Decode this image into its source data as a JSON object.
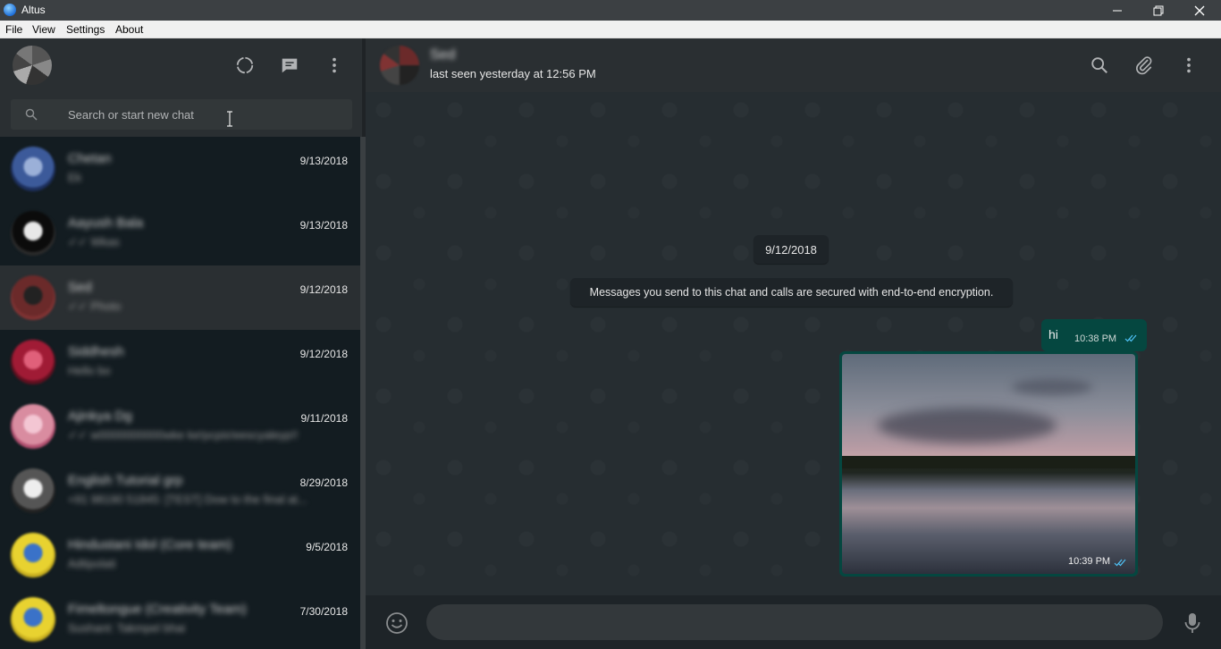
{
  "window": {
    "title": "Altus"
  },
  "menu": [
    "File",
    "View",
    "Settings",
    "About"
  ],
  "sidebar": {
    "search_placeholder": "Search or start new chat",
    "chats": [
      {
        "name": "Chetan",
        "preview": "Ek",
        "date": "9/13/2018",
        "avatar_colors": [
          "#3c5a9a",
          "#9bb0d8",
          "#1d2f5c"
        ]
      },
      {
        "name": "Aayush Bala",
        "preview": "✓✓ Wkas",
        "date": "9/13/2018",
        "avatar_colors": [
          "#0b0b0b",
          "#e8e8e8",
          "#2a2a2a"
        ]
      },
      {
        "name": "Sed",
        "preview": "✓✓ Photo",
        "date": "9/12/2018",
        "avatar_colors": [
          "#6b2a2a",
          "#222222",
          "#803333"
        ]
      },
      {
        "name": "Siddhesh",
        "preview": "Hello bo",
        "date": "9/12/2018",
        "avatar_colors": [
          "#a01b35",
          "#e0607a",
          "#601020"
        ]
      },
      {
        "name": "Ajinkya Dg",
        "preview": "✓✓ w0000000000wke ke!pcpis!eescyaleyp!!",
        "date": "9/11/2018",
        "avatar_colors": [
          "#d98ca0",
          "#f3c6d3",
          "#b25070"
        ]
      },
      {
        "name": "English Tutorial grp",
        "preview": "+91 98190 51845: [TEST] Dow to the final at...",
        "date": "8/29/2018",
        "avatar_colors": [
          "#555555",
          "#eeeeee",
          "#222222"
        ]
      },
      {
        "name": "Hindustani Idol (Core team)",
        "preview": "Adtipolati",
        "date": "9/5/2018",
        "avatar_colors": [
          "#e8d230",
          "#3a72c8",
          "#c9b020"
        ]
      },
      {
        "name": "Fimeltongue (Creativity Team)",
        "preview": "Sushant: Takmpel bhai",
        "date": "7/30/2018",
        "avatar_colors": [
          "#e8d230",
          "#3a72c8",
          "#c9b020"
        ]
      }
    ]
  },
  "conversation": {
    "contact_name": "Sed",
    "status": "last seen yesterday at 12:56 PM",
    "date_divider": "9/12/2018",
    "encryption_note": "Messages you send to this chat and calls are secured with end-to-end encryption.",
    "messages": [
      {
        "text": "hi",
        "time": "10:38 PM"
      },
      {
        "type": "image",
        "time": "10:39 PM"
      }
    ]
  },
  "colors": {
    "accent_tick": "#4fc3f7",
    "outgoing_bubble": "#054740",
    "sidebar_bg": "#131c21"
  }
}
